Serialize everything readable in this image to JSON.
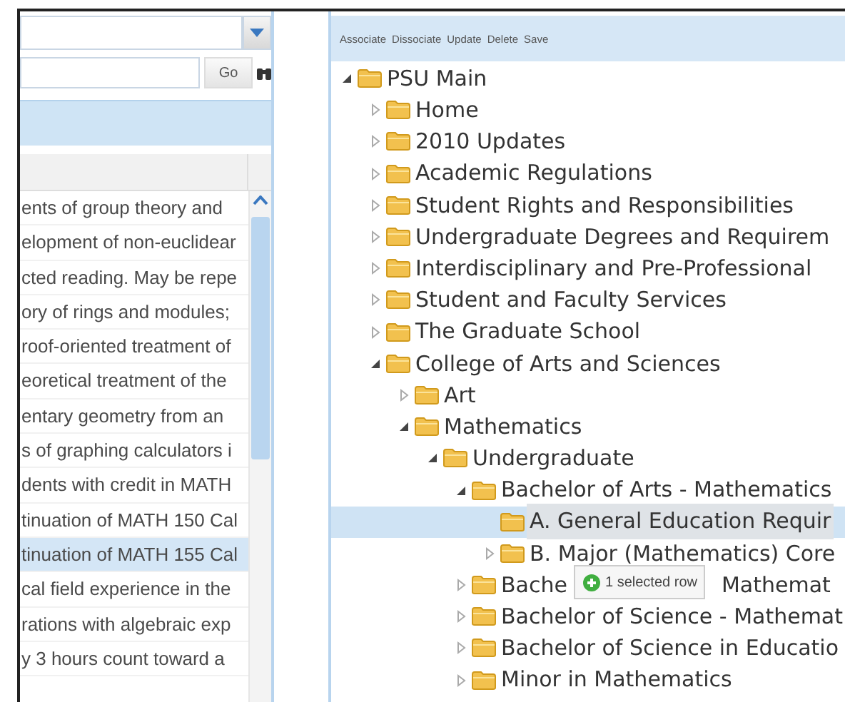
{
  "left_panel": {
    "go_button": "Go",
    "rows": [
      {
        "text": "ents of group theory and",
        "selected": false
      },
      {
        "text": "elopment of non-euclidear",
        "selected": false
      },
      {
        "text": "cted reading. May be repe",
        "selected": false
      },
      {
        "text": "ory of rings and modules;",
        "selected": false
      },
      {
        "text": "roof-oriented treatment of",
        "selected": false
      },
      {
        "text": "eoretical treatment of the",
        "selected": false
      },
      {
        "text": "entary geometry from an",
        "selected": false
      },
      {
        "text": "s of graphing calculators i",
        "selected": false
      },
      {
        "text": "dents with credit in MATH",
        "selected": false
      },
      {
        "text": "tinuation of MATH 150 Cal",
        "selected": false
      },
      {
        "text": "tinuation of MATH 155 Cal",
        "selected": true
      },
      {
        "text": "cal field experience in the",
        "selected": false
      },
      {
        "text": "rations with algebraic exp",
        "selected": false
      },
      {
        "text": "y 3 hours count toward a",
        "selected": false
      }
    ]
  },
  "right_panel": {
    "toolbar": [
      "Associate",
      "Dissociate",
      "Update",
      "Delete",
      "Save"
    ],
    "tree": [
      {
        "label": "PSU Main",
        "kind": "branch",
        "expanded": true,
        "selected": false,
        "children": [
          {
            "label": "Home",
            "kind": "branch",
            "expanded": false,
            "selected": false
          },
          {
            "label": "2010 Updates",
            "kind": "branch",
            "expanded": false,
            "selected": false
          },
          {
            "label": "Academic Regulations",
            "kind": "branch",
            "expanded": false,
            "selected": false
          },
          {
            "label": "Student Rights and Responsibilities",
            "kind": "branch",
            "expanded": false,
            "selected": false
          },
          {
            "label": "Undergraduate Degrees and Requirem",
            "kind": "branch",
            "expanded": false,
            "selected": false
          },
          {
            "label": "Interdisciplinary and Pre-Professional",
            "kind": "branch",
            "expanded": false,
            "selected": false
          },
          {
            "label": "Student and Faculty Services",
            "kind": "branch",
            "expanded": false,
            "selected": false
          },
          {
            "label": "The Graduate School",
            "kind": "branch",
            "expanded": false,
            "selected": false
          },
          {
            "label": "College of Arts and Sciences",
            "kind": "branch",
            "expanded": true,
            "selected": false,
            "children": [
              {
                "label": "Art",
                "kind": "branch",
                "expanded": false,
                "selected": false
              },
              {
                "label": "Mathematics",
                "kind": "branch",
                "expanded": true,
                "selected": false,
                "children": [
                  {
                    "label": "Undergraduate",
                    "kind": "branch",
                    "expanded": true,
                    "selected": false,
                    "children": [
                      {
                        "label": "Bachelor of Arts - Mathematics",
                        "kind": "branch",
                        "expanded": true,
                        "selected": false,
                        "children": [
                          {
                            "label": "A. General Education Requir",
                            "kind": "leaf",
                            "selected": true
                          },
                          {
                            "label": "B. Major (Mathematics) Core",
                            "kind": "branch",
                            "expanded": false,
                            "selected": false
                          }
                        ]
                      },
                      {
                        "label": "Bache",
                        "label_after": "Mathemat",
                        "kind": "branch",
                        "expanded": false,
                        "selected": false
                      },
                      {
                        "label": "Bachelor of Science - Mathemat",
                        "kind": "branch",
                        "expanded": false,
                        "selected": false
                      },
                      {
                        "label": "Bachelor of Science in Educatio",
                        "kind": "branch",
                        "expanded": false,
                        "selected": false
                      },
                      {
                        "label": "Minor in Mathematics",
                        "kind": "branch",
                        "expanded": false,
                        "selected": false
                      }
                    ]
                  }
                ]
              }
            ]
          }
        ]
      }
    ],
    "drag_tooltip": "1 selected row"
  }
}
